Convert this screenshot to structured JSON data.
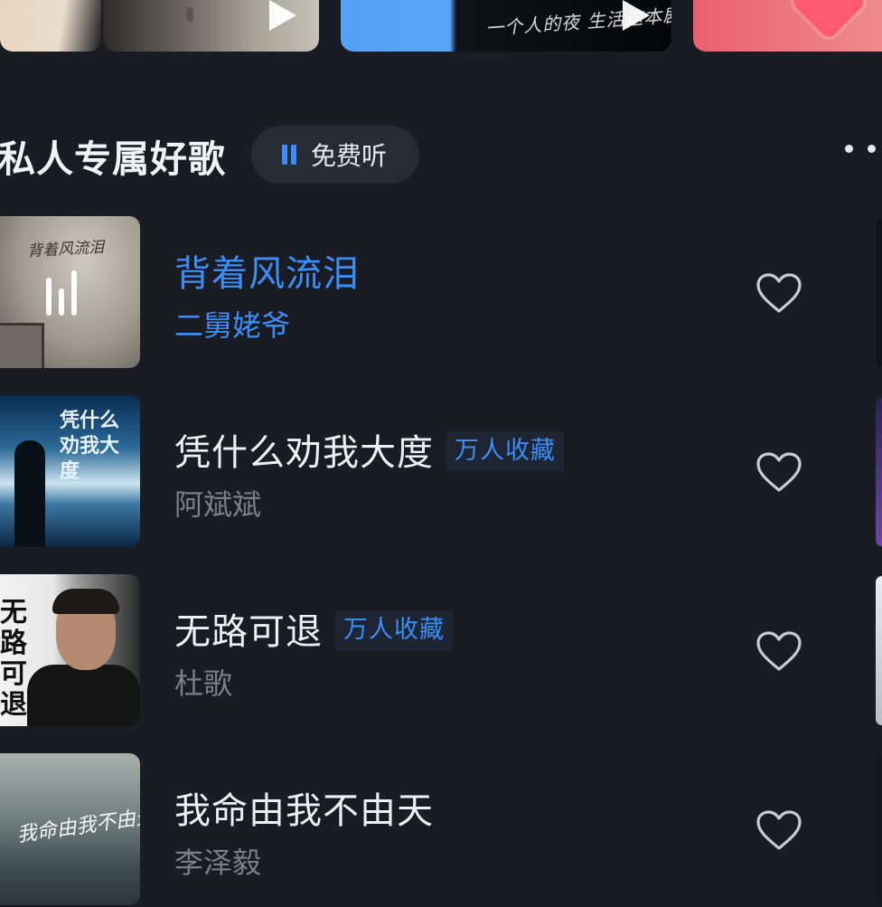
{
  "top_cards": [
    {
      "name": "card-1"
    },
    {
      "name": "card-2",
      "has_play": true
    },
    {
      "name": "card-3",
      "has_play": true,
      "text": "一个人的夜 生活这本剧"
    },
    {
      "name": "card-4"
    }
  ],
  "section": {
    "title": "私人专属好歌",
    "free_button_label": "免费听",
    "more_icon": "more-dots-icon"
  },
  "songs": [
    {
      "title": "背着风流泪",
      "artist": "二舅姥爷",
      "badge": "",
      "playing": true
    },
    {
      "title": "凭什么劝我大度",
      "artist": "阿斌斌",
      "badge": "万人收藏",
      "playing": false
    },
    {
      "title": "无路可退",
      "artist": "杜歌",
      "badge": "万人收藏",
      "playing": false
    },
    {
      "title": "我命由我不由天",
      "artist": "李泽毅",
      "badge": "",
      "playing": false
    }
  ],
  "covers": {
    "c1_text": "背着风流泪",
    "c2_text": "凭什么劝我大度",
    "c3_text": "无路可退",
    "c4_text": "我命由我不由天"
  },
  "colors": {
    "background": "#1a1c24",
    "accent": "#3d8df8",
    "text_primary": "#eef0f5",
    "text_secondary": "#7b7f89",
    "badge_bg": "#1e2533"
  }
}
